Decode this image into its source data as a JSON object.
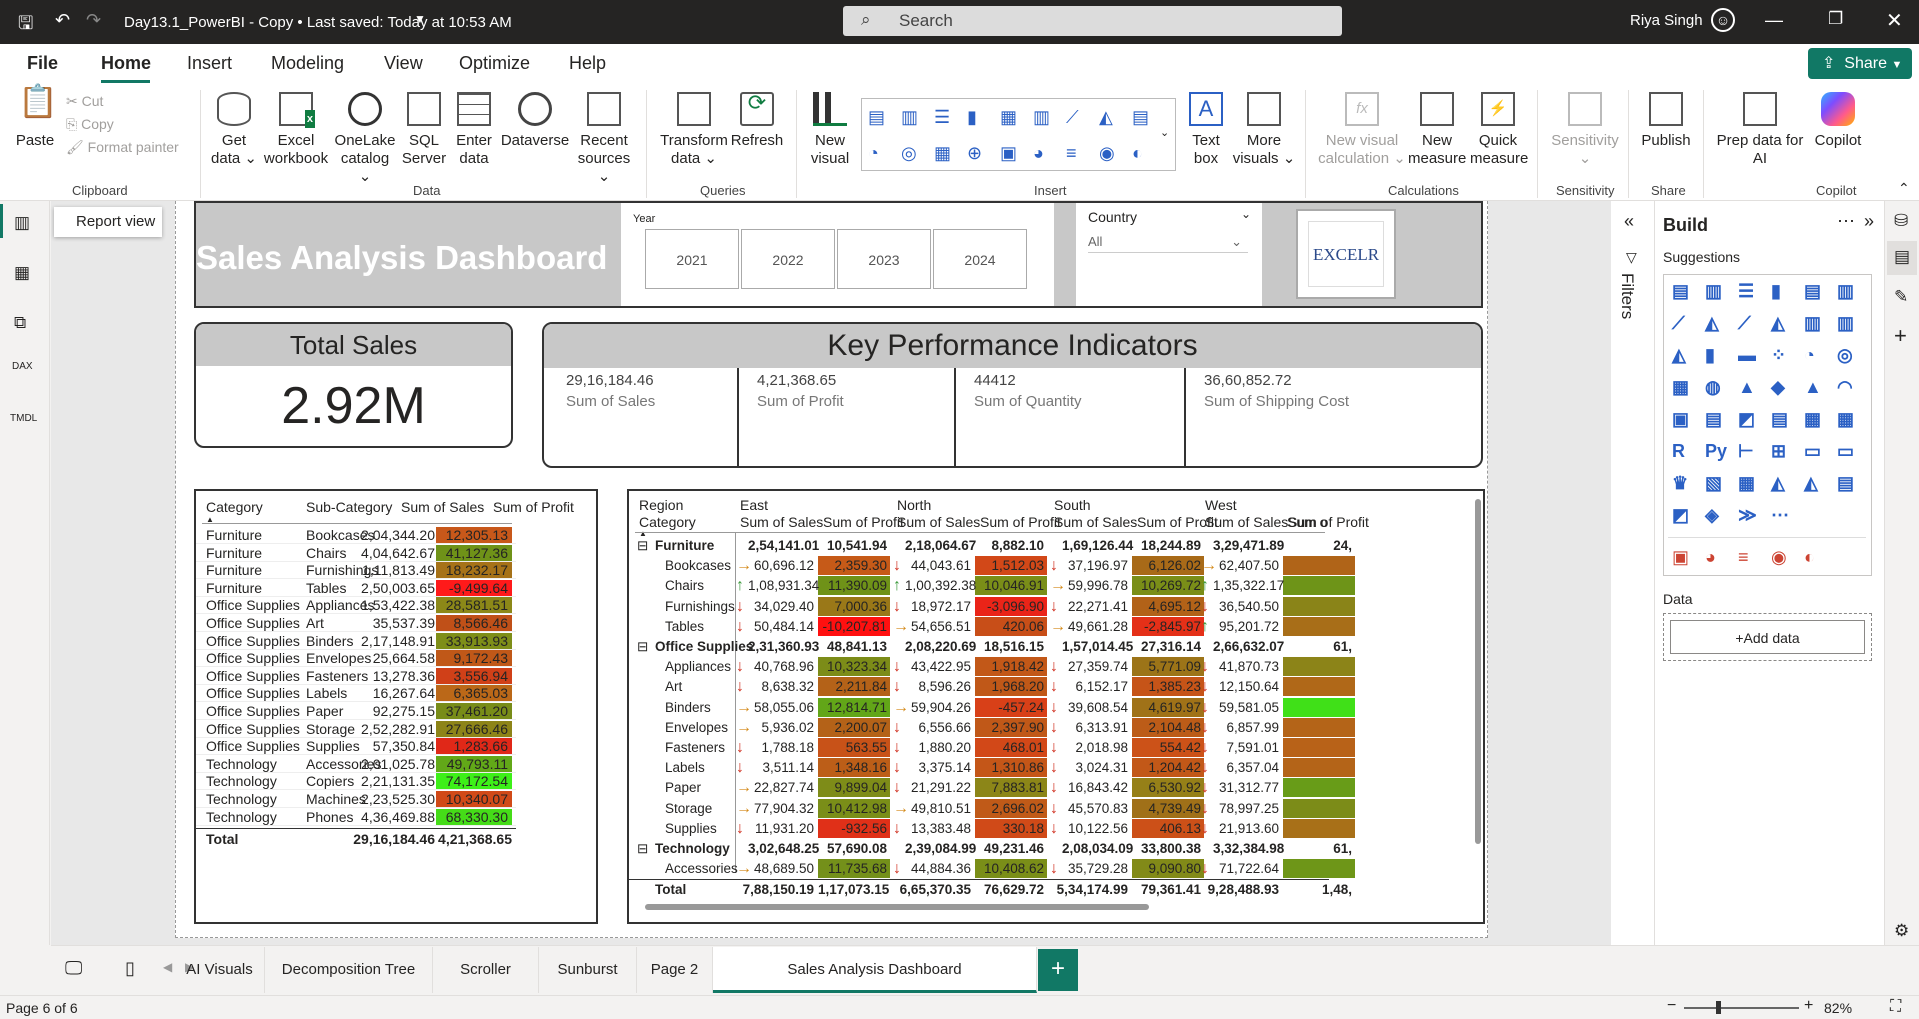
{
  "titlebar": {
    "doc": "Day13.1_PowerBI - Copy  •  Last saved: Today at 10:53 AM",
    "search": "Search",
    "user": "Riya Singh"
  },
  "menu": {
    "file": "File",
    "home": "Home",
    "insert": "Insert",
    "modeling": "Modeling",
    "view": "View",
    "optimize": "Optimize",
    "help": "Help",
    "share": "Share"
  },
  "ribbon": {
    "paste": "Paste",
    "cut": "Cut",
    "copy": "Copy",
    "format_painter": "Format painter",
    "clipboard": "Clipboard",
    "get_data": "Get data",
    "excel": "Excel workbook",
    "onelake": "OneLake catalog",
    "sql": "SQL Server",
    "enter": "Enter data",
    "dataverse": "Dataverse",
    "recent": "Recent sources",
    "data": "Data",
    "transform": "Transform data",
    "refresh": "Refresh",
    "queries": "Queries",
    "new_visual": "New visual",
    "text_box": "Text box",
    "more_visuals": "More visuals",
    "insert": "Insert",
    "new_visual_calc": "New visual calculation",
    "new_measure": "New measure",
    "quick_measure": "Quick measure",
    "calculations": "Calculations",
    "sensitivity": "Sensitivity",
    "sensitivity_grp": "Sensitivity",
    "publish": "Publish",
    "share_grp": "Share",
    "prep_ai": "Prep data for AI",
    "copilot": "Copilot",
    "copilot_grp": "Copilot"
  },
  "leftnav": {
    "tooltip": "Report view"
  },
  "dashboard": {
    "title": "Sales Analysis Dashboard",
    "year_label": "Year",
    "years": [
      "2021",
      "2022",
      "2023",
      "2024"
    ],
    "country_label": "Country",
    "country_value": "All",
    "logo": "EXCELR",
    "total_sales_label": "Total Sales",
    "total_sales_value": "2.92M",
    "kpi_title": "Key Performance Indicators",
    "kpis": [
      {
        "value": "29,16,184.46",
        "label": "Sum of Sales"
      },
      {
        "value": "4,21,368.65",
        "label": "Sum of Profit"
      },
      {
        "value": "44412",
        "label": "Sum of Quantity"
      },
      {
        "value": "36,60,852.72",
        "label": "Sum of Shipping Cost"
      }
    ]
  },
  "table1": {
    "headers": [
      "Category",
      "Sub-Category",
      "Sum of Sales",
      "Sum of Profit"
    ],
    "rows": [
      [
        "Furniture",
        "Bookcases",
        "2,04,344.20",
        "12,305.13"
      ],
      [
        "Furniture",
        "Chairs",
        "4,04,642.67",
        "41,127.36"
      ],
      [
        "Furniture",
        "Furnishings",
        "1,11,813.49",
        "18,232.17"
      ],
      [
        "Furniture",
        "Tables",
        "2,50,003.65",
        "-9,499.64"
      ],
      [
        "Office Supplies",
        "Appliances",
        "1,53,422.38",
        "28,581.51"
      ],
      [
        "Office Supplies",
        "Art",
        "35,537.39",
        "8,566.46"
      ],
      [
        "Office Supplies",
        "Binders",
        "2,17,148.91",
        "33,913.93"
      ],
      [
        "Office Supplies",
        "Envelopes",
        "25,664.58",
        "9,172.43"
      ],
      [
        "Office Supplies",
        "Fasteners",
        "13,278.36",
        "3,556.94"
      ],
      [
        "Office Supplies",
        "Labels",
        "16,267.64",
        "6,365.03"
      ],
      [
        "Office Supplies",
        "Paper",
        "92,275.15",
        "37,461.20"
      ],
      [
        "Office Supplies",
        "Storage",
        "2,52,282.91",
        "27,666.46"
      ],
      [
        "Office Supplies",
        "Supplies",
        "57,350.84",
        "1,283.66"
      ],
      [
        "Technology",
        "Accessories",
        "2,01,025.78",
        "49,793.11"
      ],
      [
        "Technology",
        "Copiers",
        "2,21,131.35",
        "74,172.54"
      ],
      [
        "Technology",
        "Machines",
        "2,23,525.30",
        "10,340.07"
      ],
      [
        "Technology",
        "Phones",
        "4,36,469.88",
        "68,330.30"
      ]
    ],
    "profit_colors": [
      "#c8581a",
      "#6f9218",
      "#a67218",
      "#ff1a1a",
      "#8c8818",
      "#c05018",
      "#7e8e18",
      "#c05818",
      "#d04018",
      "#bb6818",
      "#788c18",
      "#8d8418",
      "#e02818",
      "#62a818",
      "#3df018",
      "#d14a18",
      "#45dc18"
    ],
    "total": [
      "Total",
      "",
      "29,16,184.46",
      "4,21,368.65"
    ]
  },
  "matrix": {
    "row_header1": "Region",
    "row_header2": "Category",
    "regions": [
      "East",
      "North",
      "South",
      "West"
    ],
    "col_sales": "Sum of Sales",
    "col_profit": "Sum of Profit",
    "cut_header": "Sum o",
    "rows": [
      {
        "label": "Furniture",
        "group": true,
        "vals": [
          "2,54,141.01",
          "10,541.94",
          "2,18,064.67",
          "8,882.10",
          "1,69,126.44",
          "18,244.89",
          "3,29,471.89",
          "24,"
        ]
      },
      {
        "label": "Bookcases",
        "arrows": [
          "→",
          "↓",
          "↓",
          "→"
        ],
        "vals": [
          "60,696.12",
          "2,359.30",
          "44,043.61",
          "1,512.03",
          "37,196.97",
          "6,126.02",
          "62,407.50",
          ""
        ],
        "colors": [
          "#c65a18",
          "#d24818",
          "#a86a18",
          "#b06418"
        ]
      },
      {
        "label": "Chairs",
        "arrows": [
          "↑",
          "↑",
          "→",
          "↑"
        ],
        "vals": [
          "1,08,931.34",
          "11,390.09",
          "1,00,392.38",
          "10,046.91",
          "59,996.78",
          "10,269.72",
          "1,35,322.17",
          ""
        ],
        "colors": [
          "#6f9218",
          "#7a8e18",
          "#7a8e18",
          "#6e9418"
        ]
      },
      {
        "label": "Furnishings",
        "arrows": [
          "↓",
          "↓",
          "↓",
          "↓"
        ],
        "vals": [
          "34,029.40",
          "7,000.36",
          "18,972.17",
          "-3,096.90",
          "22,271.41",
          "4,695.12",
          "36,540.50",
          ""
        ],
        "colors": [
          "#9a7818",
          "#ea2418",
          "#b26218",
          "#8a8418"
        ]
      },
      {
        "label": "Tables",
        "arrows": [
          "↓",
          "→",
          "→",
          "↑"
        ],
        "vals": [
          "50,484.14",
          "-10,207.81",
          "54,656.51",
          "420.06",
          "49,661.28",
          "-2,845.97",
          "95,201.72",
          ""
        ],
        "colors": [
          "#ff1010",
          "#c84e18",
          "#e43018",
          "#a86e18"
        ]
      },
      {
        "label": "Office Supplies",
        "group": true,
        "vals": [
          "2,31,360.93",
          "48,841.13",
          "2,08,220.69",
          "18,516.15",
          "1,57,014.45",
          "27,316.14",
          "2,66,632.07",
          "61,"
        ]
      },
      {
        "label": "Appliances",
        "arrows": [
          "↓",
          "↓",
          "↓",
          "↓"
        ],
        "vals": [
          "40,768.96",
          "10,323.34",
          "43,422.95",
          "1,918.42",
          "27,359.74",
          "5,771.09",
          "41,870.73",
          ""
        ],
        "colors": [
          "#7c8c18",
          "#c25818",
          "#9c7418",
          "#8c8418"
        ]
      },
      {
        "label": "Art",
        "arrows": [
          "↓",
          "↓",
          "↓",
          "↓"
        ],
        "vals": [
          "8,638.32",
          "2,211.84",
          "8,596.26",
          "1,968.20",
          "6,152.17",
          "1,385.23",
          "12,150.64",
          ""
        ],
        "colors": [
          "#b46218",
          "#c05818",
          "#c65418",
          "#b06818"
        ]
      },
      {
        "label": "Binders",
        "arrows": [
          "→",
          "→",
          "↓",
          "↓"
        ],
        "vals": [
          "58,055.06",
          "12,814.71",
          "59,904.26",
          "-457.24",
          "39,608.54",
          "4,619.97",
          "59,581.05",
          ""
        ],
        "colors": [
          "#62a618",
          "#d84018",
          "#a07218",
          "#40e018"
        ]
      },
      {
        "label": "Envelopes",
        "arrows": [
          "→",
          "↓",
          "↓",
          "↓"
        ],
        "vals": [
          "5,936.02",
          "2,200.07",
          "6,556.66",
          "2,397.90",
          "6,313.91",
          "2,104.48",
          "6,857.99",
          ""
        ],
        "colors": [
          "#b46218",
          "#c05818",
          "#bc5c18",
          "#b46418"
        ]
      },
      {
        "label": "Fasteners",
        "arrows": [
          "↓",
          "↓",
          "↓",
          "↓"
        ],
        "vals": [
          "1,788.18",
          "563.55",
          "1,880.20",
          "468.01",
          "2,018.98",
          "554.42",
          "7,591.01",
          ""
        ],
        "colors": [
          "#c85218",
          "#d24818",
          "#cc5218",
          "#b86218"
        ]
      },
      {
        "label": "Labels",
        "arrows": [
          "↓",
          "↓",
          "↓",
          "↓"
        ],
        "vals": [
          "3,511.14",
          "1,348.16",
          "3,375.14",
          "1,310.86",
          "3,024.31",
          "1,204.42",
          "6,357.04",
          ""
        ],
        "colors": [
          "#bc5e18",
          "#c45618",
          "#c25818",
          "#b46418"
        ]
      },
      {
        "label": "Paper",
        "arrows": [
          "→",
          "↓",
          "↓",
          "↓"
        ],
        "vals": [
          "22,827.74",
          "9,899.04",
          "21,291.22",
          "7,883.81",
          "16,843.42",
          "6,530.92",
          "31,312.77",
          ""
        ],
        "colors": [
          "#7e8c18",
          "#8c8618",
          "#968018",
          "#689c18"
        ]
      },
      {
        "label": "Storage",
        "arrows": [
          "→",
          "→",
          "↓",
          "↓"
        ],
        "vals": [
          "77,904.32",
          "10,412.98",
          "49,810.51",
          "2,696.02",
          "45,570.83",
          "4,739.49",
          "78,997.25",
          ""
        ],
        "colors": [
          "#7a8e18",
          "#c05a18",
          "#a07018",
          "#7c8c18"
        ]
      },
      {
        "label": "Supplies",
        "arrows": [
          "↓",
          "↓",
          "↓",
          "↓"
        ],
        "vals": [
          "11,931.20",
          "-932.56",
          "13,383.48",
          "330.18",
          "10,122.56",
          "406.13",
          "21,913.60",
          ""
        ],
        "colors": [
          "#e03018",
          "#d04a18",
          "#cc5018",
          "#a87018"
        ]
      },
      {
        "label": "Technology",
        "group": true,
        "vals": [
          "3,02,648.25",
          "57,690.08",
          "2,39,084.99",
          "49,231.46",
          "2,08,034.09",
          "33,800.38",
          "3,32,384.98",
          "61,"
        ]
      },
      {
        "label": "Accessories",
        "arrows": [
          "→",
          "↓",
          "↓",
          "↓"
        ],
        "vals": [
          "48,689.50",
          "11,735.68",
          "44,884.36",
          "10,408.62",
          "35,729.28",
          "9,090.80",
          "71,722.64",
          ""
        ],
        "colors": [
          "#74901a",
          "#7a8e18",
          "#828a18",
          "#6e9618"
        ]
      }
    ],
    "total": {
      "label": "Total",
      "vals": [
        "7,88,150.19",
        "1,17,073.15",
        "6,65,370.35",
        "76,629.72",
        "5,34,174.99",
        "79,361.41",
        "9,28,488.93",
        "1,48,"
      ]
    }
  },
  "filters_label": "Filters",
  "build": {
    "title": "Build",
    "suggestions": "Suggestions",
    "data_label": "Data",
    "add_data": "+Add data"
  },
  "tabs": [
    "AI Visuals",
    "Decomposition Tree",
    "Scroller",
    "Sunburst",
    "Page 2",
    "Sales Analysis Dashboard"
  ],
  "tab_add": "+",
  "status": {
    "page": "Page 6 of 6",
    "zoom": "82%"
  }
}
